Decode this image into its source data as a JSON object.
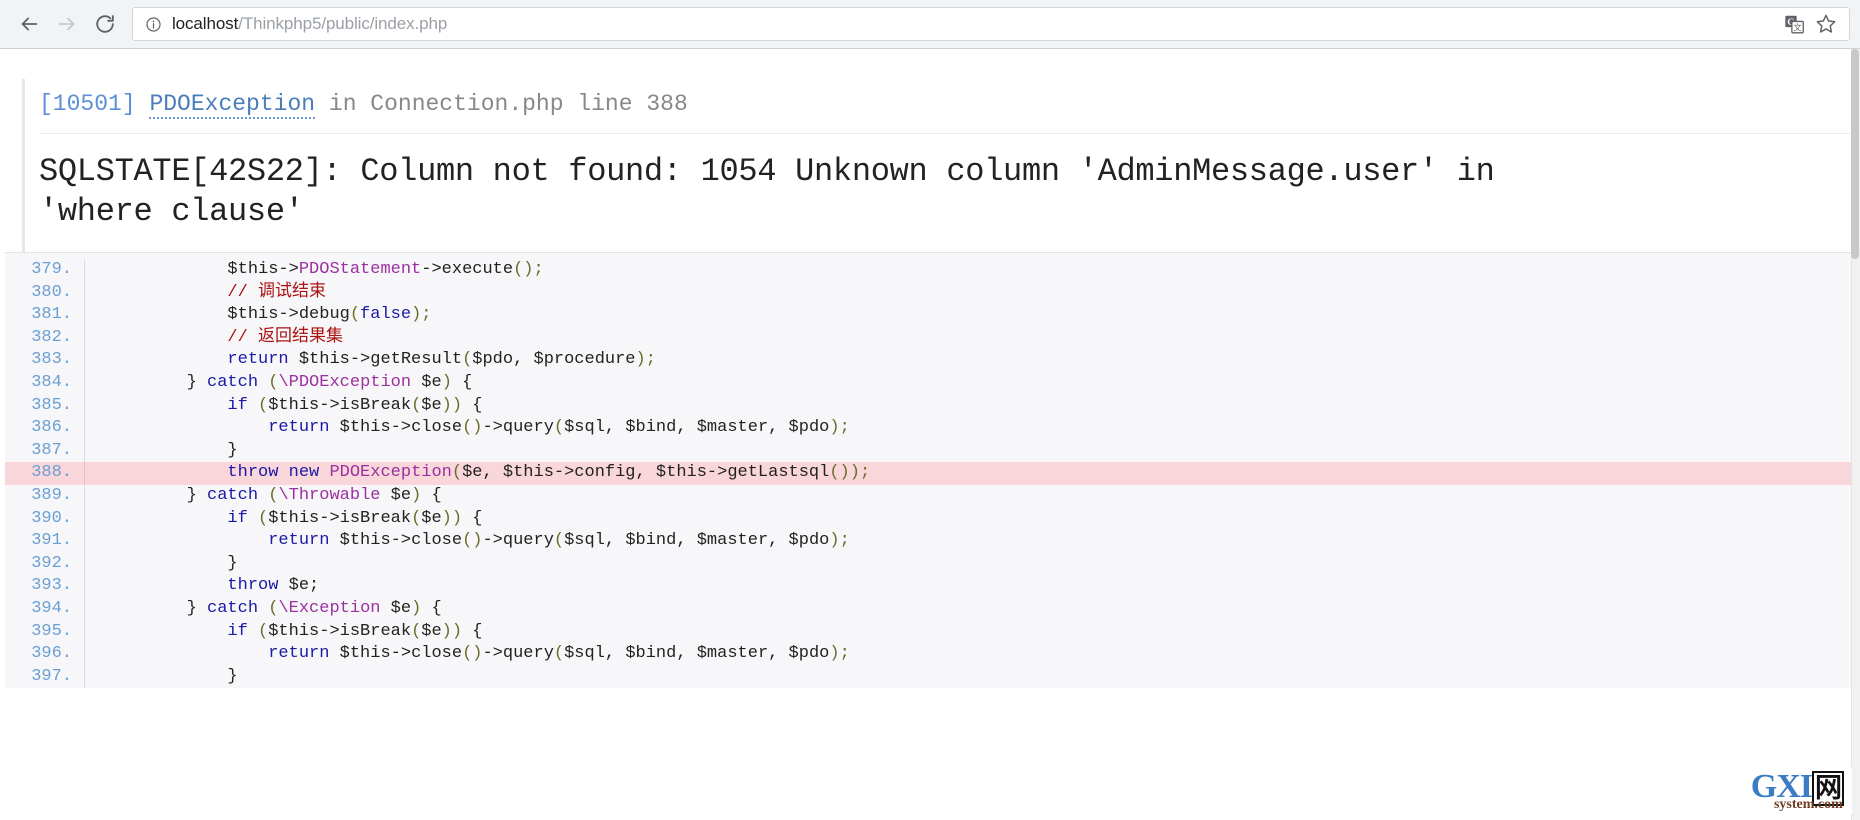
{
  "browser": {
    "back_label": "Back",
    "forward_label": "Forward",
    "reload_label": "Reload",
    "url_host": "localhost",
    "url_path": "/Thinkphp5/public/index.php",
    "url_full": "localhost/Thinkphp5/public/index.php",
    "site_info_tooltip": "View site information",
    "translate_label": "Translate this page",
    "bookmark_label": "Bookmark this page"
  },
  "exception": {
    "code": "[10501]",
    "class": "PDOException",
    "in_word": "in",
    "file": "Connection.php",
    "line_word": "line",
    "line": "388",
    "location": "in Connection.php line 388",
    "message_line1": "SQLSTATE[42S22]: Column not found: 1054 Unknown column 'AdminMessage.user' in",
    "message_line2": "'where clause'"
  },
  "code_view": {
    "highlight_line": "388",
    "highlight_color": "#f9d6d9",
    "gutter_color": "#6a9fd4",
    "background": "#f7f7f9",
    "lines": [
      {
        "no": "379.",
        "highlight": false,
        "tokens": [
          {
            "t": "            ",
            "c": "var"
          },
          {
            "t": "$this->",
            "c": "var"
          },
          {
            "t": "PDOStatement",
            "c": "cls"
          },
          {
            "t": "->execute",
            "c": "var"
          },
          {
            "t": "()",
            "c": "pun"
          },
          {
            "t": ";",
            "c": "pun"
          }
        ]
      },
      {
        "no": "380.",
        "highlight": false,
        "tokens": [
          {
            "t": "            ",
            "c": "var"
          },
          {
            "t": "// 调试结束",
            "c": "cmt"
          }
        ]
      },
      {
        "no": "381.",
        "highlight": false,
        "tokens": [
          {
            "t": "            ",
            "c": "var"
          },
          {
            "t": "$this->debug",
            "c": "var"
          },
          {
            "t": "(",
            "c": "pun"
          },
          {
            "t": "false",
            "c": "kw"
          },
          {
            "t": ")",
            "c": "pun"
          },
          {
            "t": ";",
            "c": "pun"
          }
        ]
      },
      {
        "no": "382.",
        "highlight": false,
        "tokens": [
          {
            "t": "            ",
            "c": "var"
          },
          {
            "t": "// 返回结果集",
            "c": "cmt"
          }
        ]
      },
      {
        "no": "383.",
        "highlight": false,
        "tokens": [
          {
            "t": "            ",
            "c": "var"
          },
          {
            "t": "return",
            "c": "kw"
          },
          {
            "t": " $this->getResult",
            "c": "var"
          },
          {
            "t": "(",
            "c": "pun"
          },
          {
            "t": "$pdo, $procedure",
            "c": "var"
          },
          {
            "t": ")",
            "c": "pun"
          },
          {
            "t": ";",
            "c": "pun"
          }
        ]
      },
      {
        "no": "384.",
        "highlight": false,
        "tokens": [
          {
            "t": "        } ",
            "c": "var"
          },
          {
            "t": "catch",
            "c": "kw"
          },
          {
            "t": " (",
            "c": "pun"
          },
          {
            "t": "\\PDOException",
            "c": "cls"
          },
          {
            "t": " $e",
            "c": "var"
          },
          {
            "t": ")",
            "c": "pun"
          },
          {
            "t": " {",
            "c": "var"
          }
        ]
      },
      {
        "no": "385.",
        "highlight": false,
        "tokens": [
          {
            "t": "            ",
            "c": "var"
          },
          {
            "t": "if",
            "c": "kw"
          },
          {
            "t": " (",
            "c": "pun"
          },
          {
            "t": "$this->isBreak",
            "c": "var"
          },
          {
            "t": "(",
            "c": "pun"
          },
          {
            "t": "$e",
            "c": "var"
          },
          {
            "t": "))",
            "c": "pun"
          },
          {
            "t": " {",
            "c": "var"
          }
        ]
      },
      {
        "no": "386.",
        "highlight": false,
        "tokens": [
          {
            "t": "                ",
            "c": "var"
          },
          {
            "t": "return",
            "c": "kw"
          },
          {
            "t": " $this->close",
            "c": "var"
          },
          {
            "t": "()",
            "c": "pun"
          },
          {
            "t": "->query",
            "c": "var"
          },
          {
            "t": "(",
            "c": "pun"
          },
          {
            "t": "$sql, $bind, $master, $pdo",
            "c": "var"
          },
          {
            "t": ")",
            "c": "pun"
          },
          {
            "t": ";",
            "c": "pun"
          }
        ]
      },
      {
        "no": "387.",
        "highlight": false,
        "tokens": [
          {
            "t": "            }",
            "c": "var"
          }
        ]
      },
      {
        "no": "388.",
        "highlight": true,
        "tokens": [
          {
            "t": "            ",
            "c": "var"
          },
          {
            "t": "throw new",
            "c": "kw"
          },
          {
            "t": " ",
            "c": "var"
          },
          {
            "t": "PDOException",
            "c": "cls"
          },
          {
            "t": "(",
            "c": "pun"
          },
          {
            "t": "$e, $this->config, $this->getLastsql",
            "c": "var"
          },
          {
            "t": "())",
            "c": "pun"
          },
          {
            "t": ";",
            "c": "pun"
          }
        ]
      },
      {
        "no": "389.",
        "highlight": false,
        "tokens": [
          {
            "t": "        } ",
            "c": "var"
          },
          {
            "t": "catch",
            "c": "kw"
          },
          {
            "t": " (",
            "c": "pun"
          },
          {
            "t": "\\Throwable",
            "c": "cls"
          },
          {
            "t": " $e",
            "c": "var"
          },
          {
            "t": ")",
            "c": "pun"
          },
          {
            "t": " {",
            "c": "var"
          }
        ]
      },
      {
        "no": "390.",
        "highlight": false,
        "tokens": [
          {
            "t": "            ",
            "c": "var"
          },
          {
            "t": "if",
            "c": "kw"
          },
          {
            "t": " (",
            "c": "pun"
          },
          {
            "t": "$this->isBreak",
            "c": "var"
          },
          {
            "t": "(",
            "c": "pun"
          },
          {
            "t": "$e",
            "c": "var"
          },
          {
            "t": "))",
            "c": "pun"
          },
          {
            "t": " {",
            "c": "var"
          }
        ]
      },
      {
        "no": "391.",
        "highlight": false,
        "tokens": [
          {
            "t": "                ",
            "c": "var"
          },
          {
            "t": "return",
            "c": "kw"
          },
          {
            "t": " $this->close",
            "c": "var"
          },
          {
            "t": "()",
            "c": "pun"
          },
          {
            "t": "->query",
            "c": "var"
          },
          {
            "t": "(",
            "c": "pun"
          },
          {
            "t": "$sql, $bind, $master, $pdo",
            "c": "var"
          },
          {
            "t": ")",
            "c": "pun"
          },
          {
            "t": ";",
            "c": "pun"
          }
        ]
      },
      {
        "no": "392.",
        "highlight": false,
        "tokens": [
          {
            "t": "            }",
            "c": "var"
          }
        ]
      },
      {
        "no": "393.",
        "highlight": false,
        "tokens": [
          {
            "t": "            ",
            "c": "var"
          },
          {
            "t": "throw",
            "c": "kw"
          },
          {
            "t": " $e;",
            "c": "var"
          }
        ]
      },
      {
        "no": "394.",
        "highlight": false,
        "tokens": [
          {
            "t": "        } ",
            "c": "var"
          },
          {
            "t": "catch",
            "c": "kw"
          },
          {
            "t": " (",
            "c": "pun"
          },
          {
            "t": "\\Exception",
            "c": "cls"
          },
          {
            "t": " $e",
            "c": "var"
          },
          {
            "t": ")",
            "c": "pun"
          },
          {
            "t": " {",
            "c": "var"
          }
        ]
      },
      {
        "no": "395.",
        "highlight": false,
        "tokens": [
          {
            "t": "            ",
            "c": "var"
          },
          {
            "t": "if",
            "c": "kw"
          },
          {
            "t": " (",
            "c": "pun"
          },
          {
            "t": "$this->isBreak",
            "c": "var"
          },
          {
            "t": "(",
            "c": "pun"
          },
          {
            "t": "$e",
            "c": "var"
          },
          {
            "t": "))",
            "c": "pun"
          },
          {
            "t": " {",
            "c": "var"
          }
        ]
      },
      {
        "no": "396.",
        "highlight": false,
        "tokens": [
          {
            "t": "                ",
            "c": "var"
          },
          {
            "t": "return",
            "c": "kw"
          },
          {
            "t": " $this->close",
            "c": "var"
          },
          {
            "t": "()",
            "c": "pun"
          },
          {
            "t": "->query",
            "c": "var"
          },
          {
            "t": "(",
            "c": "pun"
          },
          {
            "t": "$sql, $bind, $master, $pdo",
            "c": "var"
          },
          {
            "t": ")",
            "c": "pun"
          },
          {
            "t": ";",
            "c": "pun"
          }
        ]
      },
      {
        "no": "397.",
        "highlight": false,
        "tokens": [
          {
            "t": "            }",
            "c": "var"
          }
        ]
      }
    ]
  },
  "watermark": {
    "brand_g": "G",
    "brand_xi": "XI",
    "brand_cn": "网",
    "domain": "system.com"
  }
}
